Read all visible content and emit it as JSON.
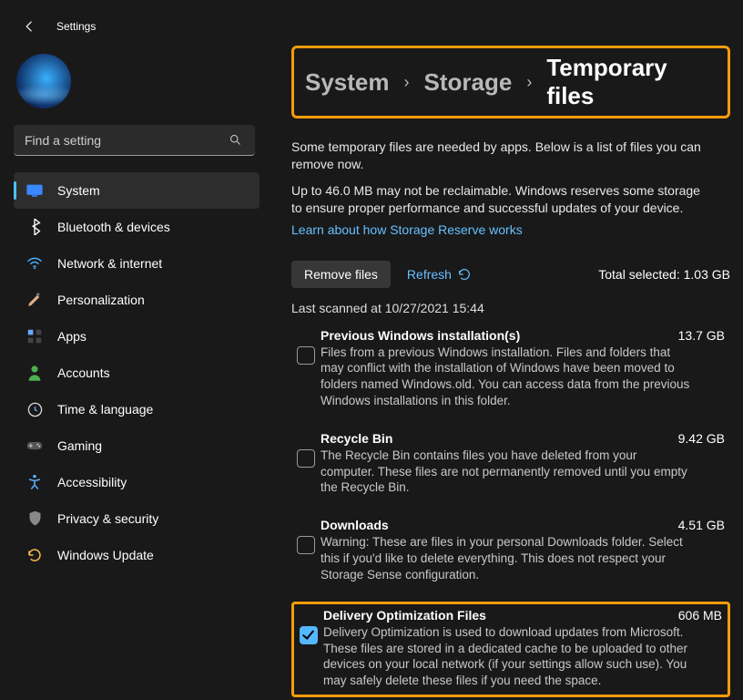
{
  "app": {
    "title": "Settings"
  },
  "search": {
    "placeholder": "Find a setting"
  },
  "sidebar": {
    "items": [
      {
        "label": "System",
        "icon": "system-icon",
        "active": true
      },
      {
        "label": "Bluetooth & devices",
        "icon": "bluetooth-icon"
      },
      {
        "label": "Network & internet",
        "icon": "wifi-icon"
      },
      {
        "label": "Personalization",
        "icon": "brush-icon"
      },
      {
        "label": "Apps",
        "icon": "apps-icon"
      },
      {
        "label": "Accounts",
        "icon": "person-icon"
      },
      {
        "label": "Time & language",
        "icon": "clock-icon"
      },
      {
        "label": "Gaming",
        "icon": "gamepad-icon"
      },
      {
        "label": "Accessibility",
        "icon": "accessibility-icon"
      },
      {
        "label": "Privacy & security",
        "icon": "shield-icon"
      },
      {
        "label": "Windows Update",
        "icon": "update-icon"
      }
    ]
  },
  "breadcrumb": {
    "parts": [
      "System",
      "Storage"
    ],
    "current": "Temporary files"
  },
  "content": {
    "description1": "Some temporary files are needed by apps. Below is a list of files you can remove now.",
    "description2": "Up to 46.0 MB may not be reclaimable. Windows reserves some storage to ensure proper performance and successful updates of your device.",
    "link_label": "Learn about how Storage Reserve works",
    "remove_label": "Remove files",
    "refresh_label": "Refresh",
    "total_label": "Total selected: 1.03 GB",
    "scan_label": "Last scanned at 10/27/2021 15:44"
  },
  "items": [
    {
      "title": "Previous Windows installation(s)",
      "size": "13.7 GB",
      "checked": false,
      "desc": "Files from a previous Windows installation.  Files and folders that may conflict with the installation of Windows have been moved to folders named Windows.old.  You can access data from the previous Windows installations in this folder."
    },
    {
      "title": "Recycle Bin",
      "size": "9.42 GB",
      "checked": false,
      "desc": "The Recycle Bin contains files you have deleted from your computer. These files are not permanently removed until you empty the Recycle Bin."
    },
    {
      "title": "Downloads",
      "size": "4.51 GB",
      "checked": false,
      "desc": "Warning: These are files in your personal Downloads folder. Select this if you'd like to delete everything. This does not respect your Storage Sense configuration."
    },
    {
      "title": "Delivery Optimization Files",
      "size": "606 MB",
      "checked": true,
      "highlight": true,
      "desc": "Delivery Optimization is used to download updates from Microsoft. These files are stored in a dedicated cache to be uploaded to other devices on your local network (if your settings allow such use). You may safely delete these files if you need the space."
    }
  ]
}
